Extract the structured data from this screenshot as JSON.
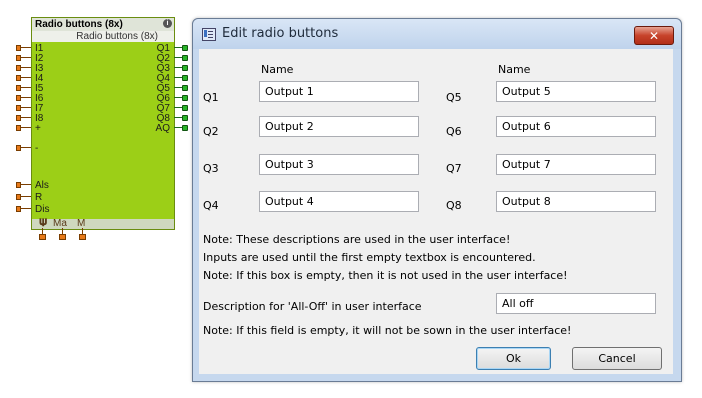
{
  "function_block": {
    "title": "Radio buttons (8x)",
    "info_icon": "i",
    "subtitle": "Radio buttons (8x)",
    "inputs": [
      "I1",
      "I2",
      "I3",
      "I4",
      "I5",
      "I6",
      "I7",
      "I8",
      "+",
      "-",
      "Als",
      "R",
      "Dis"
    ],
    "outputs": [
      "Q1",
      "Q2",
      "Q3",
      "Q4",
      "Q5",
      "Q6",
      "Q7",
      "Q8",
      "AQ"
    ],
    "bottom_labels": [
      "Ma",
      "M"
    ],
    "colors": {
      "body": "#9ccf17",
      "input_pin": "#e87a1a",
      "output_pin": "#28b428"
    }
  },
  "dialog": {
    "title": "Edit radio buttons",
    "close_glyph": "✕",
    "name_header_left": "Name",
    "name_header_right": "Name",
    "outputs_left": [
      {
        "label": "Q1",
        "value": "Output 1"
      },
      {
        "label": "Q2",
        "value": "Output 2"
      },
      {
        "label": "Q3",
        "value": "Output 3"
      },
      {
        "label": "Q4",
        "value": "Output 4"
      }
    ],
    "outputs_right": [
      {
        "label": "Q5",
        "value": "Output 5"
      },
      {
        "label": "Q6",
        "value": "Output 6"
      },
      {
        "label": "Q7",
        "value": "Output 7"
      },
      {
        "label": "Q8",
        "value": "Output 8"
      }
    ],
    "notes": [
      "Note: These descriptions are used in the user interface!",
      "Inputs are used until the first empty textbox is encountered.",
      "Note: If this box is empty, then it is not used in the user interface!"
    ],
    "all_off_label": "Description for 'All-Off' in user interface",
    "all_off_value": "All off",
    "all_off_note": "Note: If this field is empty, it will not be sown in the user interface!",
    "ok_label": "Ok",
    "cancel_label": "Cancel",
    "colors": {
      "close_button": "#c7432b",
      "title_bar": "#c6d8ee"
    }
  }
}
